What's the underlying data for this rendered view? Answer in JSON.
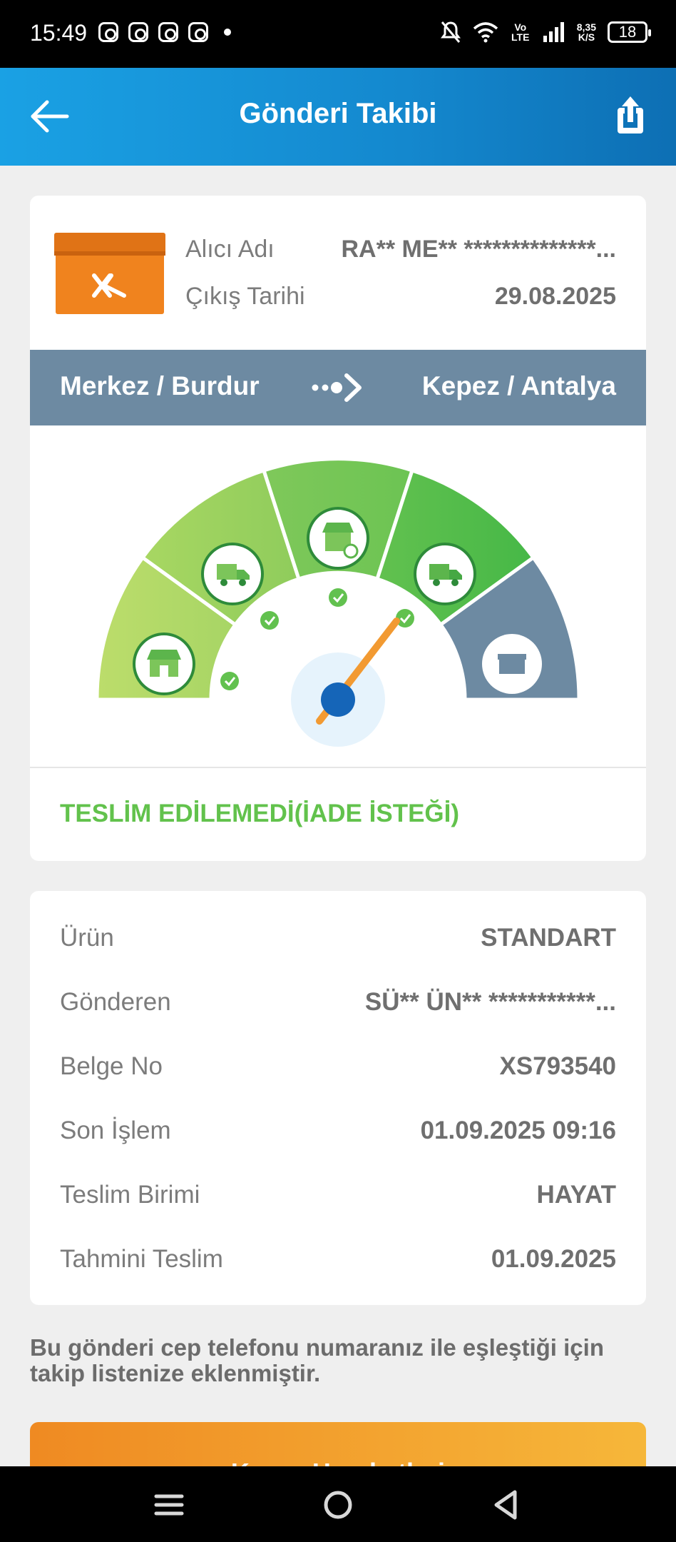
{
  "status_bar": {
    "time": "15:49",
    "network": "Vo LTE",
    "speed_value": "8,35",
    "speed_unit": "K/S",
    "battery": "18"
  },
  "header": {
    "title": "Gönderi Takibi",
    "back_icon": "arrow-left-icon",
    "share_icon": "share-icon"
  },
  "shipment": {
    "recipient_label": "Alıcı Adı",
    "recipient_value": "RA** ME** **************...",
    "departure_label": "Çıkış Tarihi",
    "departure_value": "29.08.2025",
    "route_from": "Merkez / Burdur",
    "route_to": "Kepez / Antalya",
    "status": "TESLİM EDİLEMEDİ(İADE İSTEĞİ)",
    "progress": {
      "completed_steps": 4,
      "total_steps": 5
    }
  },
  "details": [
    {
      "label": "Ürün",
      "value": "STANDART"
    },
    {
      "label": "Gönderen",
      "value": "SÜ** ÜN** ***********..."
    },
    {
      "label": "Belge No",
      "value": "XS793540"
    },
    {
      "label": "Son İşlem",
      "value": "01.09.2025 09:16"
    },
    {
      "label": "Teslim Birimi",
      "value": "HAYAT"
    },
    {
      "label": "Tahmini Teslim",
      "value": "01.09.2025"
    }
  ],
  "note": "Bu gönderi cep telefonu numaranız ile eşleştiği için takip listenize eklenmiştir.",
  "cta_label": "Kargo Hareketleri",
  "colors": {
    "header_blue": "#1488ce",
    "brand_orange": "#ef8a22",
    "route_gray": "#6d8aa2",
    "status_green": "#62c24c"
  }
}
